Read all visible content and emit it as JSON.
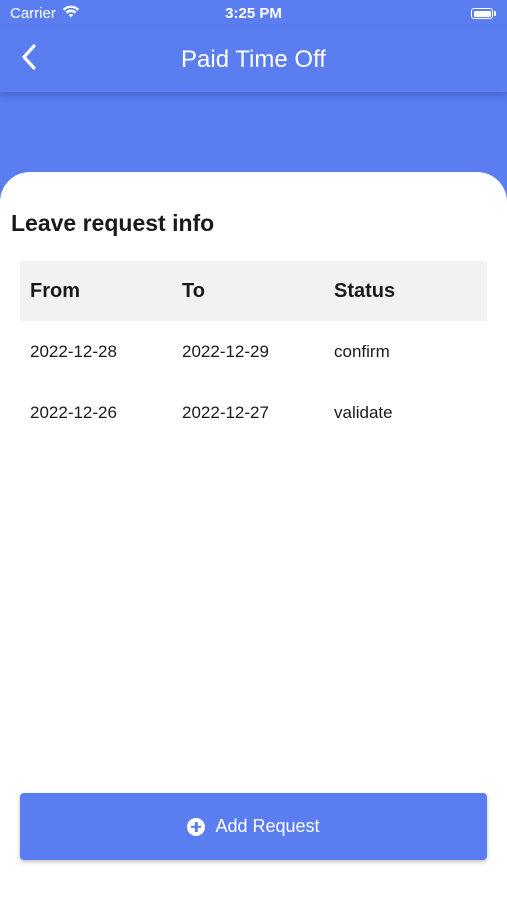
{
  "status_bar": {
    "carrier": "Carrier",
    "time": "3:25 PM",
    "wifi_icon": "wifi-icon",
    "battery_icon": "battery-icon"
  },
  "nav": {
    "title": "Paid Time Off",
    "back_icon": "chevron-left-icon"
  },
  "leave_info": {
    "title": "Leave request info",
    "columns": [
      "From",
      "To",
      "Status"
    ],
    "rows": [
      {
        "from": "2022-12-28",
        "to": "2022-12-29",
        "status": "confirm"
      },
      {
        "from": "2022-12-26",
        "to": "2022-12-27",
        "status": "validate"
      }
    ]
  },
  "footer": {
    "add_request_label": "Add Request",
    "add_icon": "plus-circle-icon"
  },
  "colors": {
    "primary": "#5a7ef0",
    "header_row": "#f2f2f2",
    "text": "#1a1a1a"
  }
}
